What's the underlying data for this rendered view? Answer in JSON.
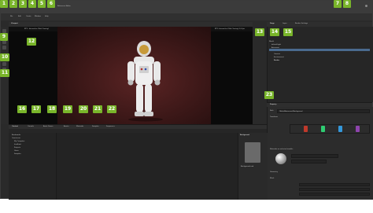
{
  "window": {
    "title": "Reference Editor"
  },
  "menu": {
    "items": [
      "File",
      "Edit",
      "Create",
      "Window",
      "Help"
    ]
  },
  "viewport": {
    "tabs": [
      "Viewport",
      "RTX - Interactive (Path Tracing)"
    ],
    "status_right": "RTX: Interactive (Path Tracing) 0.0 fps"
  },
  "right_panel": {
    "tabs": [
      "Stage",
      "Layer",
      "Render Settings"
    ],
    "outliner_items": [
      "World",
      "defaultLight",
      "Astronaut",
      "Looks",
      "Camera",
      "Environment",
      "Render"
    ]
  },
  "property_panel": {
    "tab": "Property",
    "sections": [
      "Transform",
      "Materials on selected models",
      "Geometry",
      "Mesh"
    ],
    "path_label": "Path",
    "path_value": "/World/Astronaut/Background"
  },
  "bottom_panel": {
    "tabs": [
      "Content",
      "Console",
      "Asset Stores",
      "Assets",
      "Materials",
      "Samples",
      "Sequencer"
    ],
    "tree_items": [
      "Bookmarks",
      "Omniverse",
      "My Computer",
      "localhost",
      "Projects",
      "Users",
      "Samples"
    ],
    "preview_title": "Background",
    "preview_caption": "Background.usd"
  },
  "callouts": {
    "numbers": [
      "1",
      "2",
      "3",
      "4",
      "5",
      "6",
      "7",
      "8",
      "9",
      "10",
      "11",
      "12",
      "13",
      "14",
      "15",
      "16",
      "17",
      "18",
      "19",
      "20",
      "21",
      "22",
      "23"
    ],
    "color": "#79b52a"
  },
  "swatches": {
    "red": "#c0392b",
    "green": "#2ecc71",
    "blue": "#3498db",
    "purple": "#8e44ad",
    "gold": "#f1c40f"
  }
}
